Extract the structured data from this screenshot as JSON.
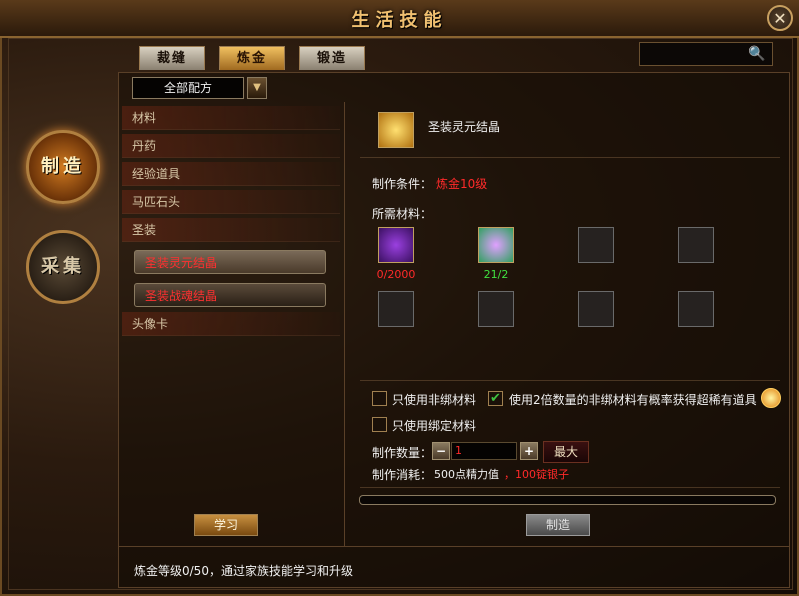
{
  "window": {
    "title": "生活技能",
    "close_label": "✕"
  },
  "tabs": [
    {
      "label": "裁缝",
      "active": false
    },
    {
      "label": "炼金",
      "active": true
    },
    {
      "label": "锻造",
      "active": false
    }
  ],
  "search": {
    "icon": "search-icon",
    "placeholder": ""
  },
  "side": {
    "make": "制造",
    "gather": "采集"
  },
  "filter": {
    "label": "全部配方"
  },
  "categories": {
    "c0": "材料",
    "c1": "丹药",
    "c2": "经验道具",
    "c3": "马匹石头",
    "c4": "圣装",
    "c5": "头像卡"
  },
  "recipes": {
    "r0": "圣装灵元结晶",
    "r1": "圣装战魂结晶"
  },
  "learn_label": "学习",
  "detail": {
    "item_name": "圣装灵元结晶",
    "cond_label": "制作条件：",
    "cond_value": "炼金10级",
    "materials_label": "所需材料：",
    "mat0_count": "0/2000",
    "mat1_count": "21/2",
    "opt1": "只使用非绑材料",
    "opt2": "使用2倍数量的非绑材料有概率获得超稀有道具",
    "opt3": "只使用绑定材料",
    "qty_label": "制作数量：",
    "qty_value": "1",
    "max_label": "最大",
    "cost_label": "制作消耗：",
    "cost_energy": "500点精力值",
    "cost_silver": "，100锭银子",
    "make_label": "制造"
  },
  "progress": 0,
  "status": "炼金等级0/50，通过家族技能学习和升级"
}
